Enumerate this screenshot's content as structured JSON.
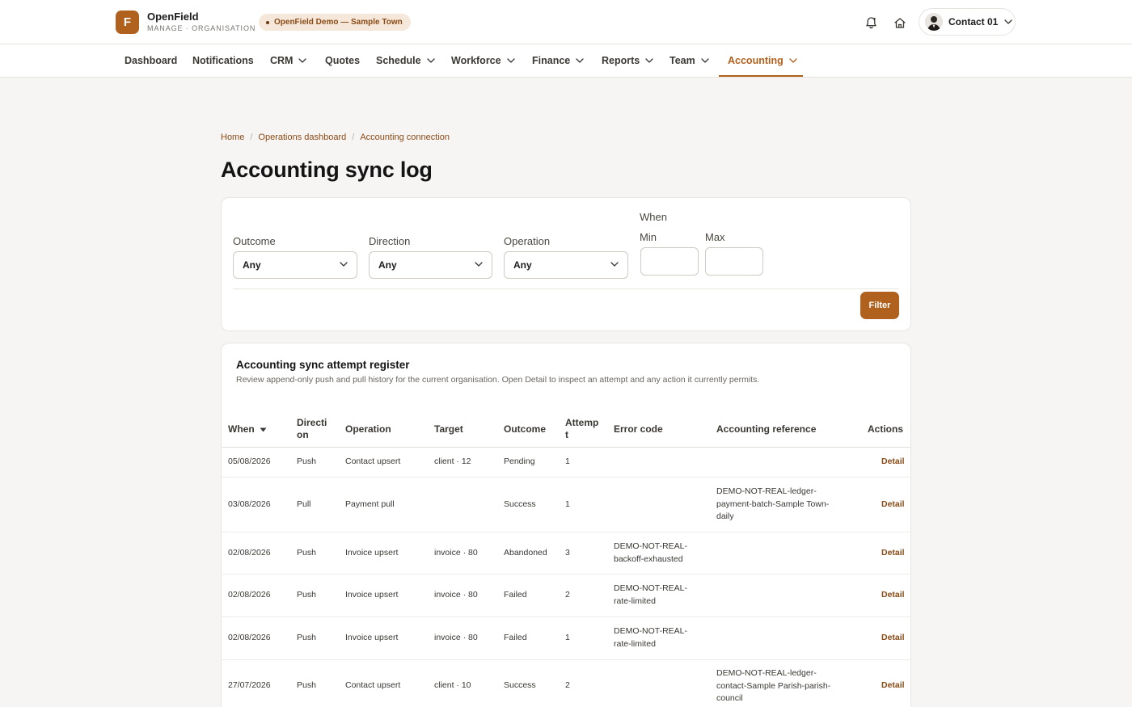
{
  "header": {
    "logo_letter": "F",
    "brand_name": "OpenField",
    "brand_sub": "MANAGE · ORGANISATION",
    "org_pill": "OpenField Demo — Sample Town",
    "user_name": "Contact 01"
  },
  "nav": {
    "items": [
      {
        "label": "Dashboard",
        "has_menu": false
      },
      {
        "label": "Notifications",
        "has_menu": false
      },
      {
        "label": "CRM",
        "has_menu": true
      },
      {
        "label": "Quotes",
        "has_menu": false
      },
      {
        "label": "Schedule",
        "has_menu": true
      },
      {
        "label": "Workforce",
        "has_menu": true
      },
      {
        "label": "Finance",
        "has_menu": true
      },
      {
        "label": "Reports",
        "has_menu": true
      },
      {
        "label": "Team",
        "has_menu": true
      },
      {
        "label": "Accounting",
        "has_menu": true,
        "active": true
      }
    ]
  },
  "breadcrumb": [
    "Home",
    "Operations dashboard",
    "Accounting connection"
  ],
  "page_title": "Accounting sync log",
  "filters": {
    "outcome_label": "Outcome",
    "outcome_value": "Any",
    "direction_label": "Direction",
    "direction_value": "Any",
    "operation_label": "Operation",
    "operation_value": "Any",
    "when_label": "When",
    "min_label": "Min",
    "max_label": "Max",
    "min_value": "",
    "max_value": "",
    "filter_button": "Filter"
  },
  "register": {
    "title": "Accounting sync attempt register",
    "description": "Review append-only push and pull history for the current organisation. Open Detail to inspect an attempt and any action it currently permits.",
    "columns": [
      "When",
      "Directi\non",
      "Operation",
      "Target",
      "Outcome",
      "Attemp\nt",
      "Error code",
      "Accounting reference",
      "Actions"
    ],
    "rows": [
      {
        "when": "05/08/2026",
        "direction": "Push",
        "operation": "Contact upsert",
        "target": "client · 12",
        "outcome": "Pending",
        "attempt": "1",
        "error": "",
        "reference": "",
        "action": "Detail"
      },
      {
        "when": "03/08/2026",
        "direction": "Pull",
        "operation": "Payment pull",
        "target": "",
        "outcome": "Success",
        "attempt": "1",
        "error": "",
        "reference": "DEMO-NOT-REAL-ledger-\npayment-batch-Sample Town-\ndaily",
        "action": "Detail"
      },
      {
        "when": "02/08/2026",
        "direction": "Push",
        "operation": "Invoice upsert",
        "target": "invoice · 80",
        "outcome": "Abandoned",
        "attempt": "3",
        "error": "DEMO-NOT-REAL-\nbackoff-exhausted",
        "reference": "",
        "action": "Detail"
      },
      {
        "when": "02/08/2026",
        "direction": "Push",
        "operation": "Invoice upsert",
        "target": "invoice · 80",
        "outcome": "Failed",
        "attempt": "2",
        "error": "DEMO-NOT-REAL-\nrate-limited",
        "reference": "",
        "action": "Detail"
      },
      {
        "when": "02/08/2026",
        "direction": "Push",
        "operation": "Invoice upsert",
        "target": "invoice · 80",
        "outcome": "Failed",
        "attempt": "1",
        "error": "DEMO-NOT-REAL-\nrate-limited",
        "reference": "",
        "action": "Detail"
      },
      {
        "when": "27/07/2026",
        "direction": "Push",
        "operation": "Contact upsert",
        "target": "client · 10",
        "outcome": "Success",
        "attempt": "2",
        "error": "",
        "reference": "DEMO-NOT-REAL-ledger-\ncontact-Sample Parish-parish-\ncouncil",
        "action": "Detail"
      }
    ]
  },
  "colors": {
    "accent": "#b0611e",
    "accent_dark": "#8a4a16",
    "pill_bg": "#f5e8da"
  },
  "icons": {
    "bell": "bell-icon",
    "home": "home-icon",
    "chevron": "chevron-down-icon",
    "sort": "sort-down-icon"
  }
}
